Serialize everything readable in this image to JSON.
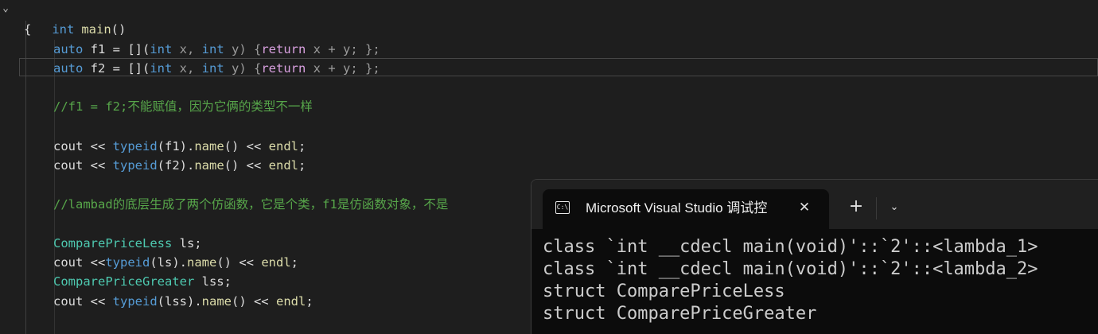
{
  "editor": {
    "line1": {
      "kw": "int",
      "fn": "main",
      "rest": "()"
    },
    "line2": "{",
    "line3": {
      "kw_auto": "auto",
      "var": "f1",
      "eq": " = [](",
      "kw_int1": "int",
      "p1": " x, ",
      "kw_int2": "int",
      "p2": " y) {",
      "kw_ret": "return",
      "body": " x + y; };"
    },
    "line4": {
      "kw_auto": "auto",
      "var": "f2",
      "eq": " = [](",
      "kw_int1": "int",
      "p1": " x, ",
      "kw_int2": "int",
      "p2": " y) {",
      "kw_ret": "return",
      "body": " x + y; };"
    },
    "comment1": "//f1 = f2;不能赋值，因为它俩的类型不一样",
    "cout1": {
      "cout": "cout",
      "op": " << ",
      "typeid": "typeid",
      "arg": "(f1).",
      "name": "name",
      "tail": "() << ",
      "endl": "endl",
      ";": ";"
    },
    "cout2": {
      "cout": "cout",
      "op": " << ",
      "typeid": "typeid",
      "arg": "(f2).",
      "name": "name",
      "tail": "() << ",
      "endl": "endl",
      ";": ";"
    },
    "comment2": "//lambad的底层生成了两个仿函数，它是个类，f1是仿函数对象，不是",
    "decl1": {
      "type": "ComparePriceLess",
      "var": " ls;"
    },
    "cout3": {
      "cout": "cout",
      "op": " <<",
      "typeid": "typeid",
      "arg": "(ls).",
      "name": "name",
      "tail": "() << ",
      "endl": "endl",
      ";": ";"
    },
    "decl2": {
      "type": "ComparePriceGreater",
      "var": " lss;"
    },
    "cout4": {
      "cout": "cout",
      "op": " << ",
      "typeid": "typeid",
      "arg": "(lss).",
      "name": "name",
      "tail": "() << ",
      "endl": "endl",
      ";": ";"
    }
  },
  "console": {
    "tab_title": "Microsoft Visual Studio 调试控",
    "tab_icon_text": "C:\\",
    "close_glyph": "✕",
    "new_tab_glyph": "+",
    "dropdown_glyph": "⌄",
    "output": [
      "class `int __cdecl main(void)'::`2'::<lambda_1>",
      "class `int __cdecl main(void)'::`2'::<lambda_2>",
      "struct ComparePriceLess",
      "struct ComparePriceGreater"
    ]
  },
  "icons": {
    "fold": "chevron-down-icon",
    "terminal": "terminal-icon"
  },
  "colors": {
    "keyword": "#569cd6",
    "type": "#4ec9b0",
    "function": "#dcdcaa",
    "comment": "#57a64a",
    "console_bg": "#0c0c0c"
  }
}
